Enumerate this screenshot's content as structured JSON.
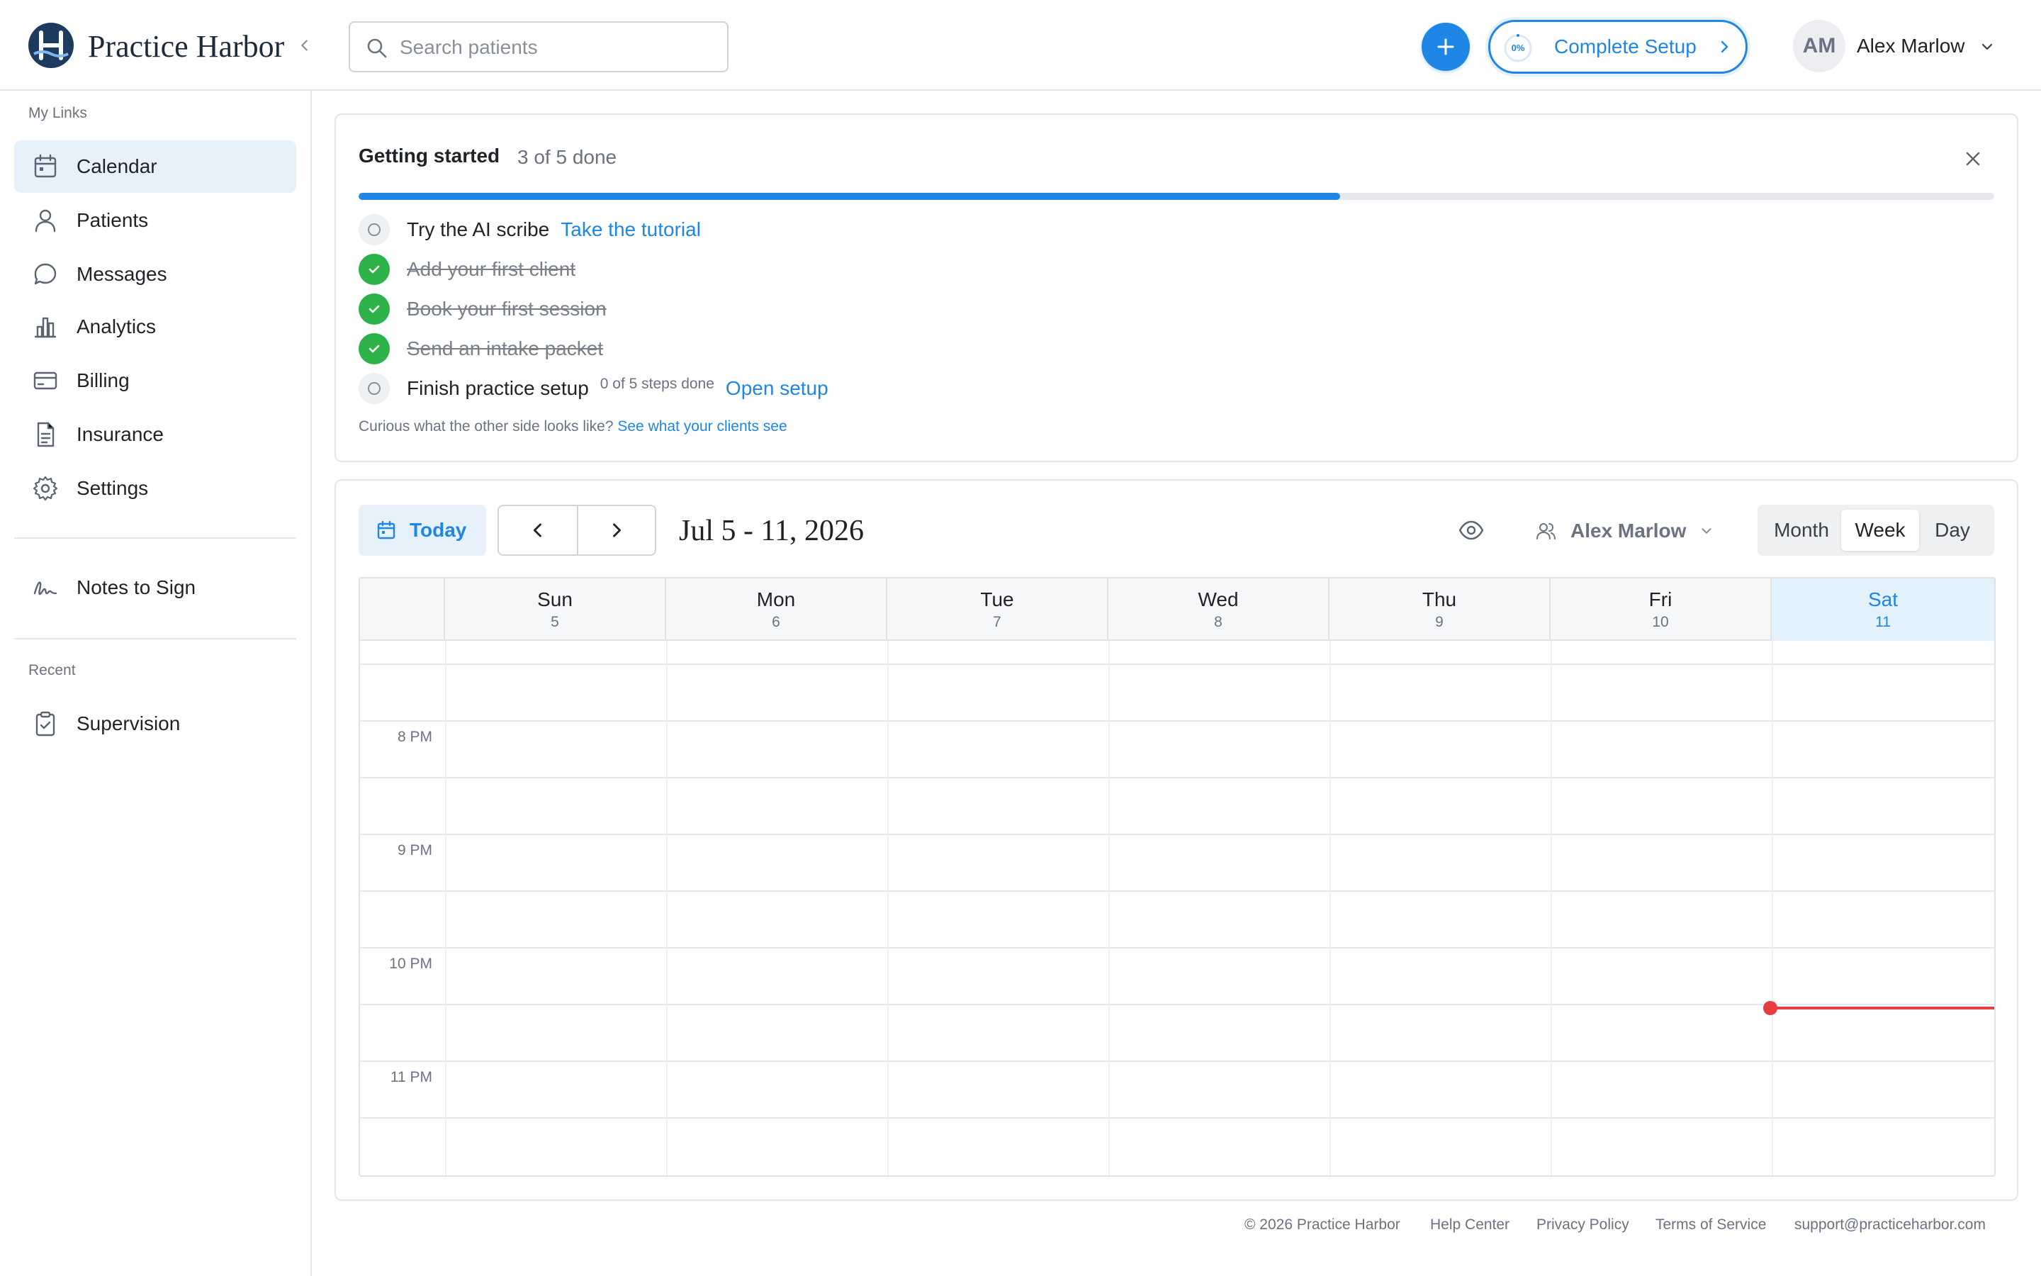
{
  "brand": {
    "name": "Practice Harbor"
  },
  "search": {
    "placeholder": "Search patients"
  },
  "header": {
    "setup_progress": "0%",
    "setup_label": "Complete Setup",
    "user_initials": "AM",
    "user_name": "Alex Marlow"
  },
  "sidebar": {
    "my_links_label": "My Links",
    "items": [
      {
        "label": "Calendar",
        "icon": "calendar-icon",
        "active": true
      },
      {
        "label": "Patients",
        "icon": "user-icon"
      },
      {
        "label": "Messages",
        "icon": "message-icon"
      },
      {
        "label": "Analytics",
        "icon": "bar-chart-icon"
      },
      {
        "label": "Billing",
        "icon": "credit-card-icon"
      },
      {
        "label": "Insurance",
        "icon": "document-icon"
      },
      {
        "label": "Settings",
        "icon": "gear-icon"
      }
    ],
    "notes_to_sign": "Notes to Sign",
    "recent_label": "Recent",
    "recent_items": [
      {
        "label": "Supervision",
        "icon": "clipboard-check-icon"
      }
    ]
  },
  "getting_started": {
    "title": "Getting started",
    "count": "3 of 5 done",
    "progress_fraction": 0.6,
    "tasks": [
      {
        "label": "Try the AI scribe",
        "done": false,
        "link": "Take the tutorial"
      },
      {
        "label": "Add your first client",
        "done": true
      },
      {
        "label": "Book your first session",
        "done": true
      },
      {
        "label": "Send an intake packet",
        "done": true
      },
      {
        "label": "Finish practice setup",
        "done": false,
        "sub": "0 of 5 steps done",
        "link": "Open setup"
      }
    ],
    "footer_text": "Curious what the other side looks like?",
    "footer_link": "See what your clients see"
  },
  "calendar": {
    "today_label": "Today",
    "date_range": "Jul 5 - 11, 2026",
    "staff": "Alex Marlow",
    "views": [
      "Month",
      "Week",
      "Day"
    ],
    "active_view": "Week",
    "days": [
      {
        "name": "Sun",
        "date": "5"
      },
      {
        "name": "Mon",
        "date": "6"
      },
      {
        "name": "Tue",
        "date": "7"
      },
      {
        "name": "Wed",
        "date": "8"
      },
      {
        "name": "Thu",
        "date": "9"
      },
      {
        "name": "Fri",
        "date": "10"
      },
      {
        "name": "Sat",
        "date": "11",
        "today": true
      }
    ],
    "hours": [
      "8 PM",
      "9 PM",
      "10 PM",
      "11 PM"
    ]
  },
  "footer": {
    "copyright": "© 2026 Practice Harbor",
    "help": "Help Center",
    "privacy": "Privacy Policy",
    "terms": "Terms of Service",
    "email": "support@practiceharbor.com"
  },
  "colors": {
    "accent": "#1f86e5",
    "success": "#2db34a",
    "now_indicator": "#e63e3e",
    "active_nav_bg": "#e7f1fb"
  }
}
